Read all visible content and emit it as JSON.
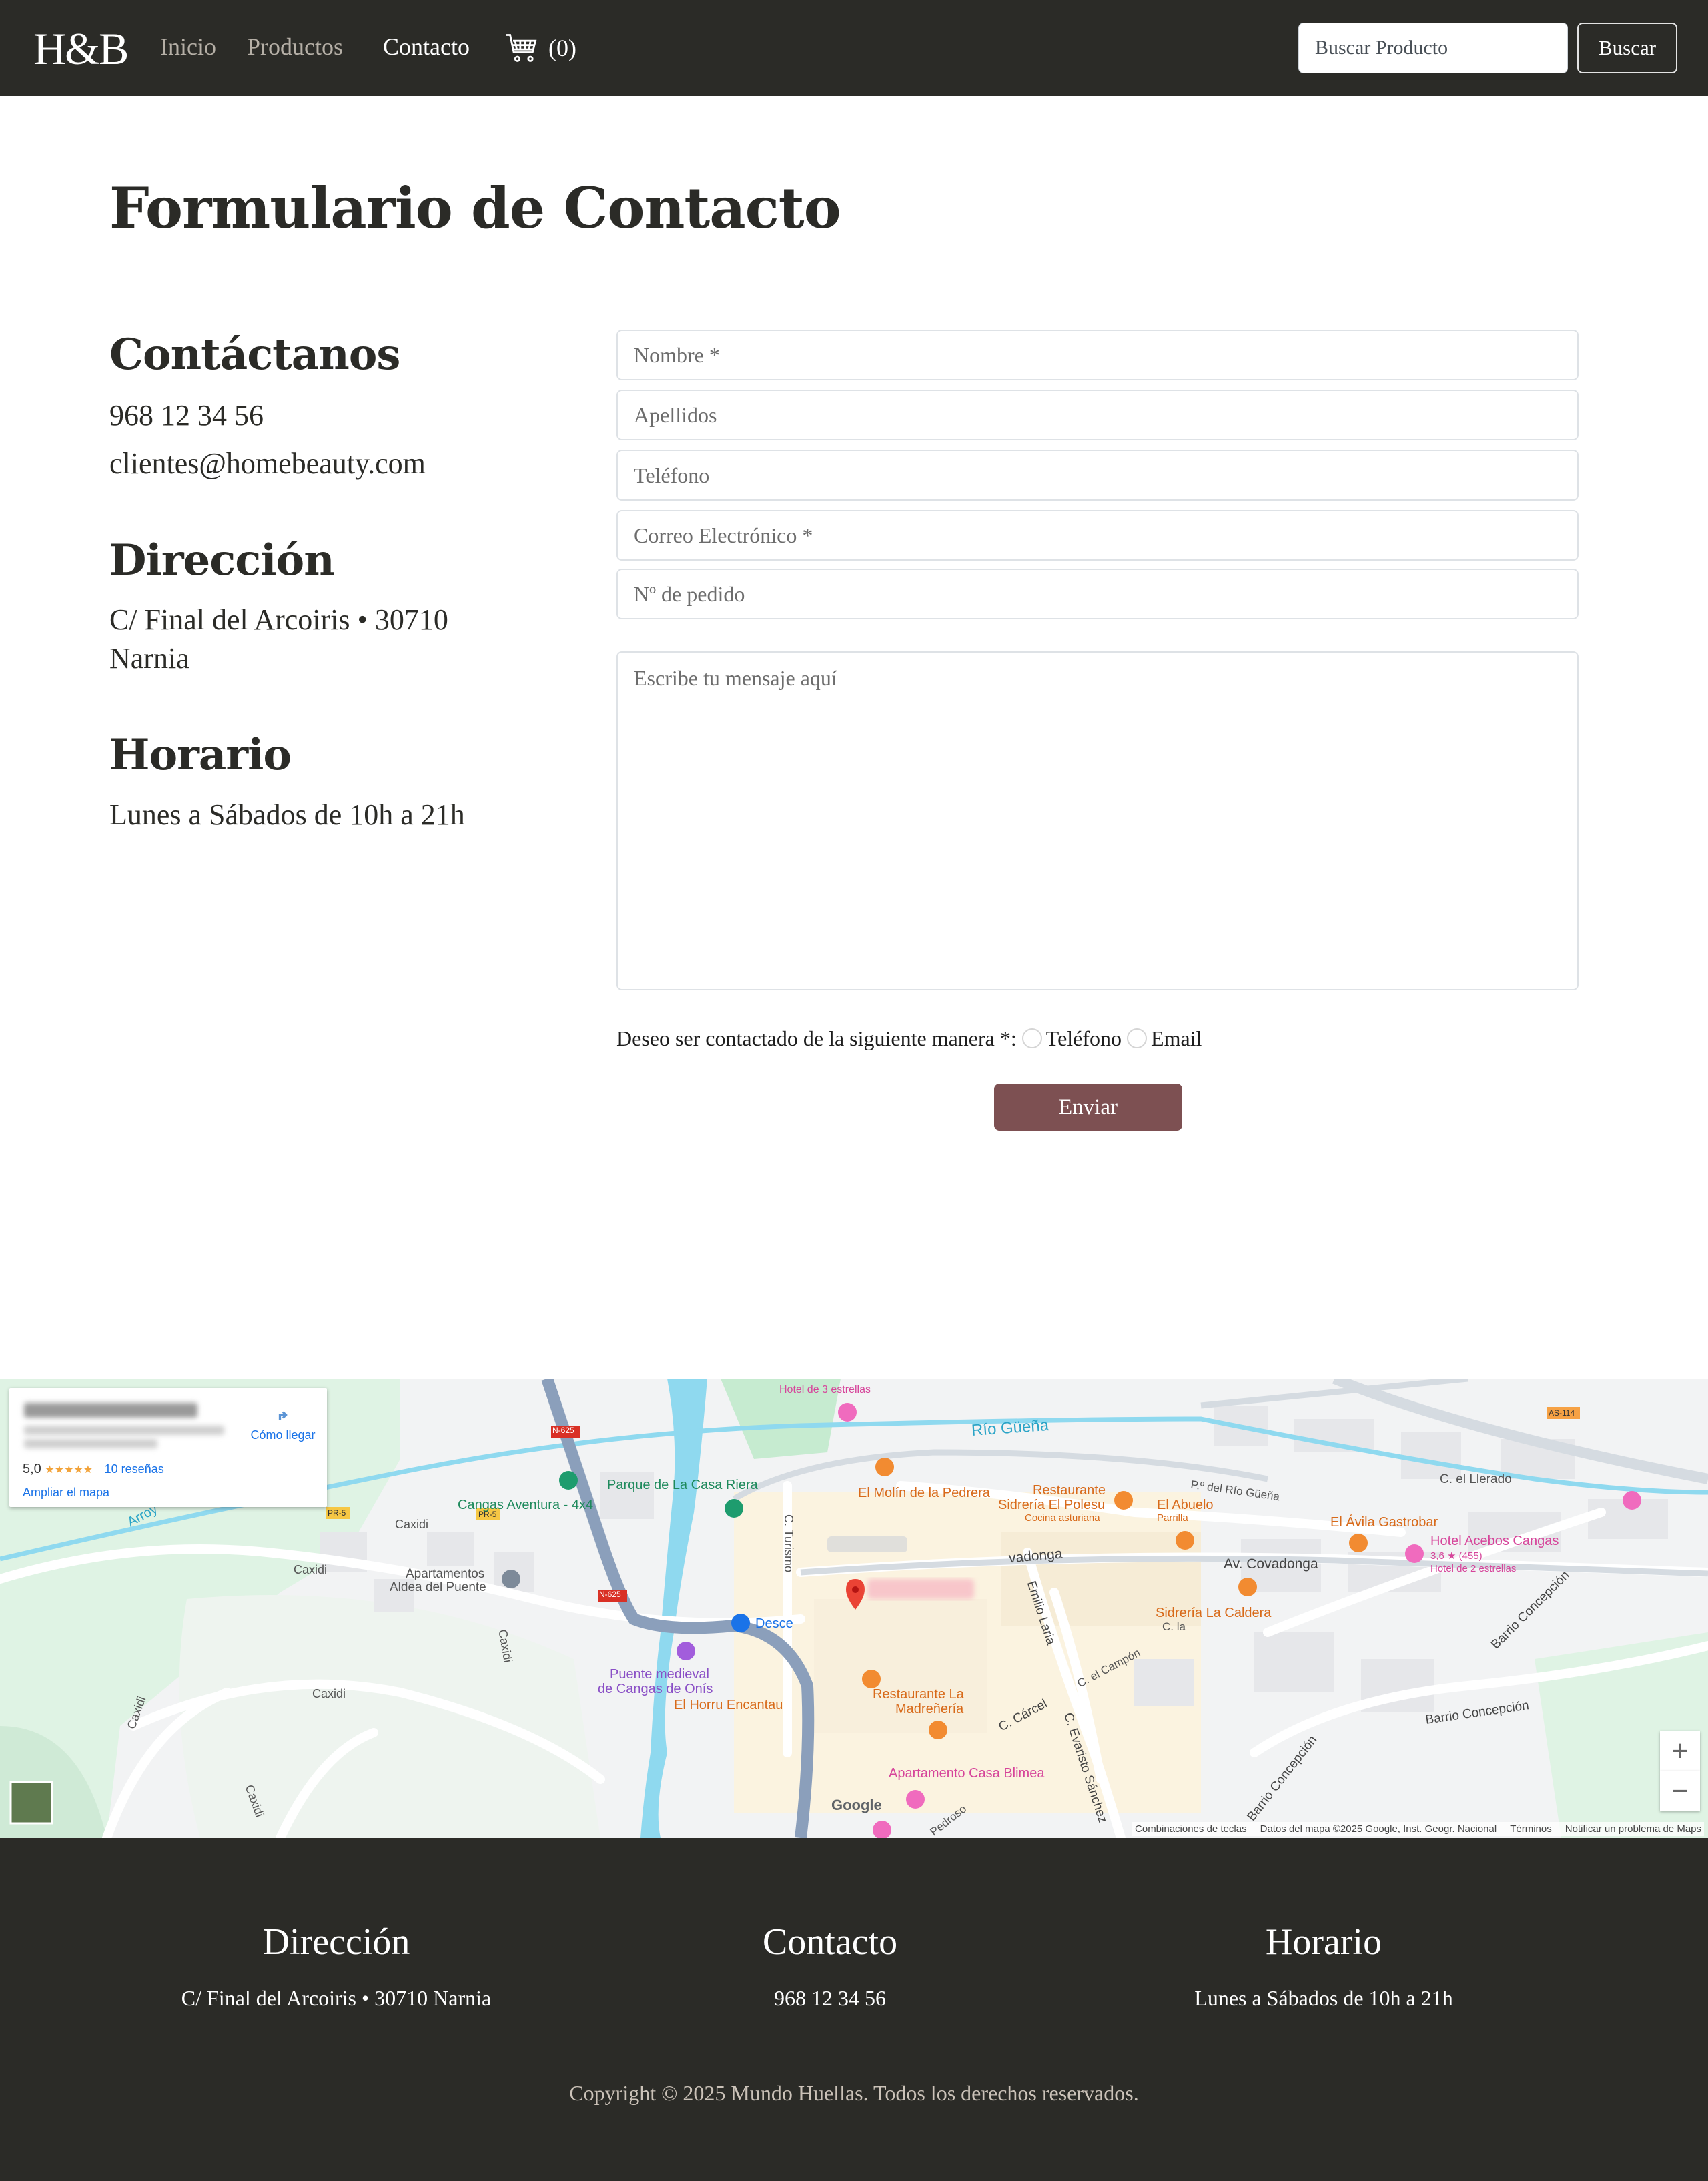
{
  "nav": {
    "brand": "H&B",
    "links": [
      "Inicio",
      "Productos",
      "Contacto"
    ],
    "cart_count": "(0)",
    "search_placeholder": "Buscar Producto",
    "search_button": "Buscar"
  },
  "main": {
    "title": "Formulario de Contacto",
    "contact": {
      "heading": "Contáctanos",
      "phone": "968 12 34 56",
      "email": "clientes@homebeauty.com"
    },
    "address": {
      "heading": "Dirección",
      "line1": "C/ Final del Arcoiris • 30710",
      "line2": "Narnia"
    },
    "hours": {
      "heading": "Horario",
      "text": "Lunes a Sábados de 10h a 21h"
    }
  },
  "form": {
    "name_placeholder": "Nombre *",
    "surname_placeholder": "Apellidos",
    "phone_placeholder": "Teléfono",
    "email_placeholder": "Correo Electrónico *",
    "order_placeholder": "Nº de pedido",
    "message_placeholder": "Escribe tu mensaje aquí",
    "contact_pref_label": "Deseo ser contactado de la siguiente manera *:",
    "option_phone": "Teléfono",
    "option_email": "Email",
    "submit": "Enviar"
  },
  "map": {
    "card": {
      "directions": "Cómo llegar",
      "rating": "5,0",
      "stars": "★★★★★",
      "reviews": "10 reseñas",
      "enlarge": "Ampliar el mapa"
    },
    "labels": {
      "hotel3": "Hotel de 3 estrellas",
      "rio_guena": "Río Güeña",
      "parque": "Parque de La Casa Riera",
      "cangas_aventura": "Cangas Aventura - 4x4",
      "molin": "El Molín de la Pedrera",
      "polesu1": "Restaurante",
      "polesu2": "Sidrería El Polesu",
      "polesu3": "Cocina asturiana",
      "abuelo1": "El Abuelo",
      "abuelo2": "Parrilla",
      "avila": "El Ávila Gastrobar",
      "acebos1": "Hotel Acebos Cangas",
      "acebos2": "3,6 ★ (455)",
      "acebos3": "Hotel de 2 estrellas",
      "c_llerado": "C. el Llerado",
      "paseo_rio": "P.º del Río Güeña",
      "av_covadonga": "Av. Covadonga",
      "covadonga_partial": "vadonga",
      "sidreria_caldera": "Sidrería La Caldera",
      "c_la": "C. la",
      "apartamentos1": "Apartamentos",
      "apartamentos2": "Aldea del Puente",
      "caxidi": "Caxidi",
      "c_turismo": "C. Turismo",
      "emilio_laria": "Emilio Laria",
      "c_campon": "C. el Campón",
      "c_carcel": "C. Cárcel",
      "c_evaristo": "C. Evaristo Sánchez",
      "barrio_concepcion": "Barrio Concepción",
      "puente1": "Puente medieval",
      "puente2": "de Cangas de Onís",
      "horru": "El Horru Encantau",
      "madreneria1": "Restaurante La",
      "madreneria2": "Madreñería",
      "blimea": "Apartamento Casa Blimea",
      "pedroso": "Pedroso",
      "desce": "Desce",
      "arroyo": "Arroy",
      "n625": "N-625",
      "pr5": "PR-5",
      "as114": "AS-114",
      "google": "Google"
    },
    "footer": [
      "Combinaciones de teclas",
      "Datos del mapa ©2025 Google, Inst. Geogr. Nacional",
      "Términos",
      "Notificar un problema de Maps"
    ],
    "zoom_in": "+",
    "zoom_out": "−"
  },
  "footer": {
    "address_heading": "Dirección",
    "address_text": "C/ Final del Arcoiris • 30710 Narnia",
    "contact_heading": "Contacto",
    "contact_text": "968 12 34 56",
    "hours_heading": "Horario",
    "hours_text": "Lunes a Sábados de 10h a 21h",
    "copyright": "Copyright © 2025 Mundo Huellas. Todos los derechos reservados."
  },
  "colors": {
    "dark": "#2b2b27",
    "button": "#7d5052",
    "muted_link": "#b5afa6"
  },
  "icons": [
    "cart-icon",
    "directions-icon",
    "map-pin-icon",
    "restaurant-icon",
    "hotel-icon",
    "park-icon"
  ]
}
